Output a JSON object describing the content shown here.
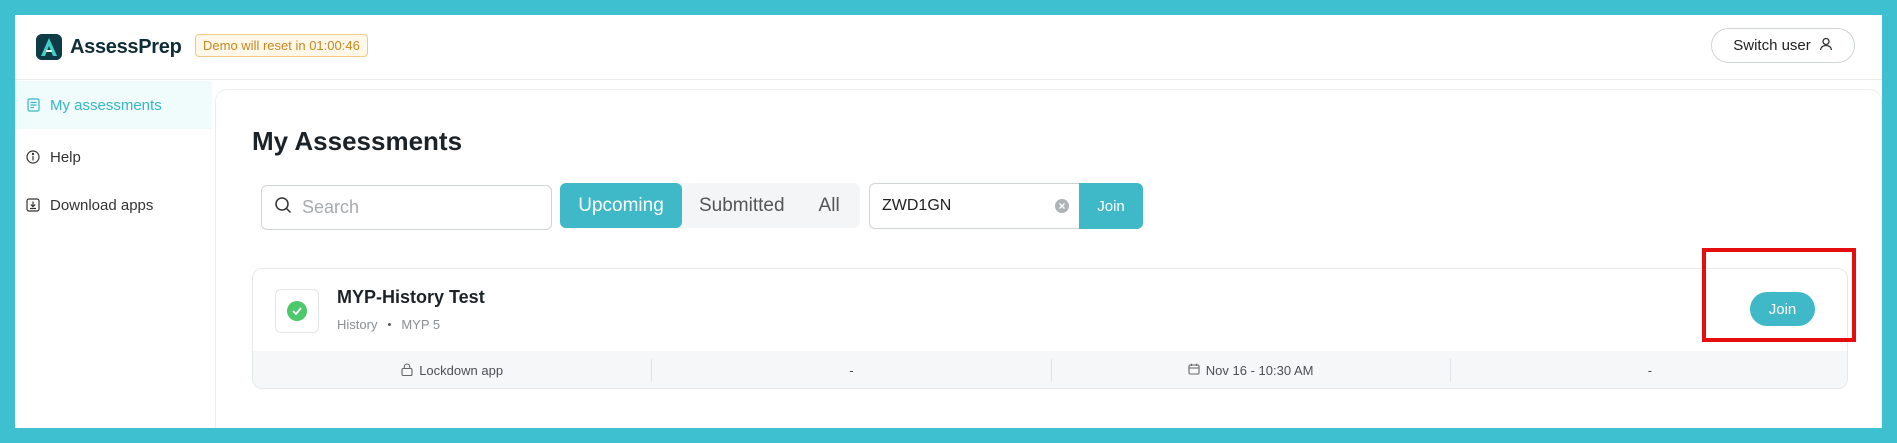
{
  "app": {
    "name": "AssessPrep"
  },
  "header": {
    "demo_badge": "Demo will reset in 01:00:46",
    "switch_user_label": "Switch user"
  },
  "sidebar": {
    "items": [
      {
        "label": "My assessments",
        "icon": "document-icon",
        "active": true
      },
      {
        "label": "Help",
        "icon": "info-icon",
        "active": false
      },
      {
        "label": "Download apps",
        "icon": "download-icon",
        "active": false
      }
    ]
  },
  "main": {
    "title": "My Assessments",
    "search": {
      "placeholder": "Search",
      "value": ""
    },
    "tabs": [
      {
        "label": "Upcoming",
        "active": true
      },
      {
        "label": "Submitted",
        "active": false
      },
      {
        "label": "All",
        "active": false
      }
    ],
    "code_input": {
      "value": "ZWD1GN"
    },
    "code_join_label": "Join"
  },
  "assessments": [
    {
      "title": "MYP-History Test",
      "subject": "History",
      "separator": "•",
      "grade": "MYP 5",
      "status": "complete",
      "join_label": "Join",
      "footer": {
        "mode": "Lockdown app",
        "col2": "-",
        "date": "Nov 16 - 10:30 AM",
        "col4": "-"
      }
    }
  ],
  "colors": {
    "accent": "#3fb9c8",
    "frame": "#3fc0d0",
    "highlight": "#e50d0d",
    "success": "#4cc86a",
    "badge_text": "#c9871f"
  }
}
